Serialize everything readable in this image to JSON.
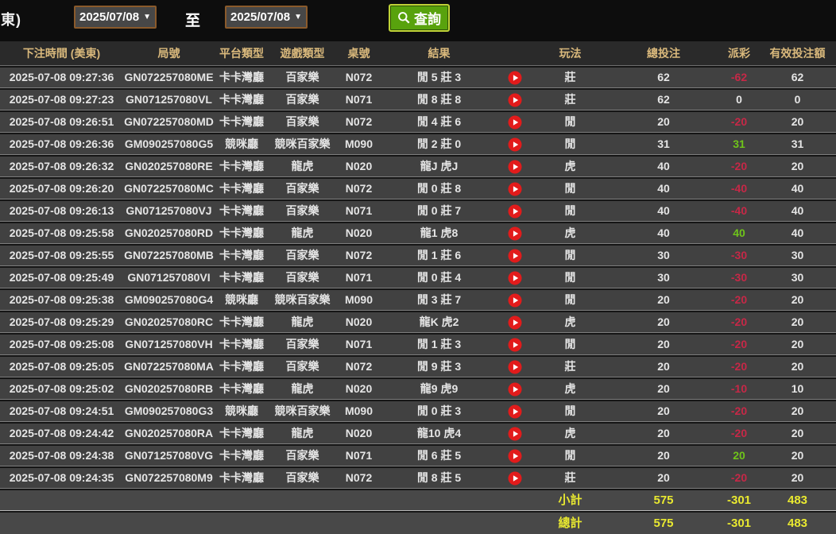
{
  "topbar": {
    "corner_label": "東)",
    "date_from": "2025/07/08",
    "to_label": "至",
    "date_to": "2025/07/08",
    "search_label": "查詢"
  },
  "icons": {
    "dropdown_arrow": "▼",
    "search": "magnifier-glass",
    "play": "white-play-triangle-in-red-circle"
  },
  "colors": {
    "page_background": "#151515",
    "topbar_background": "#0d0d0d",
    "header_background": "#2a2a2a",
    "header_text": "#dab97c",
    "row_background": "#414141",
    "row_text": "#e5e5e5",
    "payout_negative": "#c62847",
    "payout_positive": "#6fc41a",
    "totals_yellow": "#e9e930",
    "search_button_green": "#58a20d",
    "search_button_border": "#bfd337",
    "date_picker_border": "#8a5a2b",
    "play_icon_red": "#e21b1b"
  },
  "table": {
    "columns": {
      "time": "下注時間 (美東)",
      "round": "局號",
      "platform": "平台類型",
      "game": "遊戲類型",
      "table": "桌號",
      "result": "結果",
      "play": "",
      "bettype": "玩法",
      "total": "總投注",
      "payout": "派彩",
      "valid": "有效投注額"
    },
    "rows": [
      {
        "time": "2025-07-08 09:27:36",
        "round": "GN072257080ME",
        "platform": "卡卡灣廳",
        "game": "百家樂",
        "table": "N072",
        "result": "閒 5 莊 3",
        "bettype": "莊",
        "total": "62",
        "payout": "-62",
        "valid": "62"
      },
      {
        "time": "2025-07-08 09:27:23",
        "round": "GN071257080VL",
        "platform": "卡卡灣廳",
        "game": "百家樂",
        "table": "N071",
        "result": "閒 8 莊 8",
        "bettype": "莊",
        "total": "62",
        "payout": "0",
        "valid": "0"
      },
      {
        "time": "2025-07-08 09:26:51",
        "round": "GN072257080MD",
        "platform": "卡卡灣廳",
        "game": "百家樂",
        "table": "N072",
        "result": "閒 4 莊 6",
        "bettype": "閒",
        "total": "20",
        "payout": "-20",
        "valid": "20"
      },
      {
        "time": "2025-07-08 09:26:36",
        "round": "GM090257080G5",
        "platform": "競咪廳",
        "game": "競咪百家樂",
        "table": "M090",
        "result": "閒 2 莊 0",
        "bettype": "閒",
        "total": "31",
        "payout": "31",
        "valid": "31"
      },
      {
        "time": "2025-07-08 09:26:32",
        "round": "GN020257080RE",
        "platform": "卡卡灣廳",
        "game": "龍虎",
        "table": "N020",
        "result": "龍J 虎J",
        "bettype": "虎",
        "total": "40",
        "payout": "-20",
        "valid": "20"
      },
      {
        "time": "2025-07-08 09:26:20",
        "round": "GN072257080MC",
        "platform": "卡卡灣廳",
        "game": "百家樂",
        "table": "N072",
        "result": "閒 0 莊 8",
        "bettype": "閒",
        "total": "40",
        "payout": "-40",
        "valid": "40"
      },
      {
        "time": "2025-07-08 09:26:13",
        "round": "GN071257080VJ",
        "platform": "卡卡灣廳",
        "game": "百家樂",
        "table": "N071",
        "result": "閒 0 莊 7",
        "bettype": "閒",
        "total": "40",
        "payout": "-40",
        "valid": "40"
      },
      {
        "time": "2025-07-08 09:25:58",
        "round": "GN020257080RD",
        "platform": "卡卡灣廳",
        "game": "龍虎",
        "table": "N020",
        "result": "龍1 虎8",
        "bettype": "虎",
        "total": "40",
        "payout": "40",
        "valid": "40"
      },
      {
        "time": "2025-07-08 09:25:55",
        "round": "GN072257080MB",
        "platform": "卡卡灣廳",
        "game": "百家樂",
        "table": "N072",
        "result": "閒 1 莊 6",
        "bettype": "閒",
        "total": "30",
        "payout": "-30",
        "valid": "30"
      },
      {
        "time": "2025-07-08 09:25:49",
        "round": "GN071257080VI",
        "platform": "卡卡灣廳",
        "game": "百家樂",
        "table": "N071",
        "result": "閒 0 莊 4",
        "bettype": "閒",
        "total": "30",
        "payout": "-30",
        "valid": "30"
      },
      {
        "time": "2025-07-08 09:25:38",
        "round": "GM090257080G4",
        "platform": "競咪廳",
        "game": "競咪百家樂",
        "table": "M090",
        "result": "閒 3 莊 7",
        "bettype": "閒",
        "total": "20",
        "payout": "-20",
        "valid": "20"
      },
      {
        "time": "2025-07-08 09:25:29",
        "round": "GN020257080RC",
        "platform": "卡卡灣廳",
        "game": "龍虎",
        "table": "N020",
        "result": "龍K 虎2",
        "bettype": "虎",
        "total": "20",
        "payout": "-20",
        "valid": "20"
      },
      {
        "time": "2025-07-08 09:25:08",
        "round": "GN071257080VH",
        "platform": "卡卡灣廳",
        "game": "百家樂",
        "table": "N071",
        "result": "閒 1 莊 3",
        "bettype": "閒",
        "total": "20",
        "payout": "-20",
        "valid": "20"
      },
      {
        "time": "2025-07-08 09:25:05",
        "round": "GN072257080MA",
        "platform": "卡卡灣廳",
        "game": "百家樂",
        "table": "N072",
        "result": "閒 9 莊 3",
        "bettype": "莊",
        "total": "20",
        "payout": "-20",
        "valid": "20"
      },
      {
        "time": "2025-07-08 09:25:02",
        "round": "GN020257080RB",
        "platform": "卡卡灣廳",
        "game": "龍虎",
        "table": "N020",
        "result": "龍9 虎9",
        "bettype": "虎",
        "total": "20",
        "payout": "-10",
        "valid": "10"
      },
      {
        "time": "2025-07-08 09:24:51",
        "round": "GM090257080G3",
        "platform": "競咪廳",
        "game": "競咪百家樂",
        "table": "M090",
        "result": "閒 0 莊 3",
        "bettype": "閒",
        "total": "20",
        "payout": "-20",
        "valid": "20"
      },
      {
        "time": "2025-07-08 09:24:42",
        "round": "GN020257080RA",
        "platform": "卡卡灣廳",
        "game": "龍虎",
        "table": "N020",
        "result": "龍10 虎4",
        "bettype": "虎",
        "total": "20",
        "payout": "-20",
        "valid": "20"
      },
      {
        "time": "2025-07-08 09:24:38",
        "round": "GN071257080VG",
        "platform": "卡卡灣廳",
        "game": "百家樂",
        "table": "N071",
        "result": "閒 6 莊 5",
        "bettype": "閒",
        "total": "20",
        "payout": "20",
        "valid": "20"
      },
      {
        "time": "2025-07-08 09:24:35",
        "round": "GN072257080M9",
        "platform": "卡卡灣廳",
        "game": "百家樂",
        "table": "N072",
        "result": "閒 8 莊 5",
        "bettype": "莊",
        "total": "20",
        "payout": "-20",
        "valid": "20"
      }
    ],
    "subtotal": {
      "label": "小計",
      "total": "575",
      "payout": "-301",
      "valid": "483"
    },
    "grand_total": {
      "label": "總計",
      "total": "575",
      "payout": "-301",
      "valid": "483"
    }
  }
}
